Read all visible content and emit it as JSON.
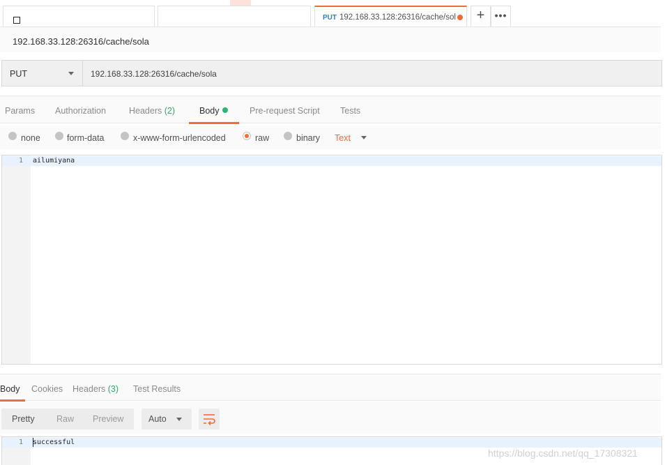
{
  "tabs": [
    {
      "title": ""
    },
    {
      "title": ""
    },
    {
      "method": "PUT",
      "title": "192.168.33.128:26316/cache/sol",
      "unsaved": true
    }
  ],
  "tab_actions": {
    "add_label": "+",
    "more_label": "•••"
  },
  "request": {
    "title": "192.168.33.128:26316/cache/sola",
    "method": "PUT",
    "url": "192.168.33.128:26316/cache/sola"
  },
  "request_tabs": [
    {
      "label": "Params"
    },
    {
      "label": "Authorization"
    },
    {
      "label": "Headers",
      "count": "(2)"
    },
    {
      "label": "Body",
      "active": true
    },
    {
      "label": "Pre-request Script"
    },
    {
      "label": "Tests"
    }
  ],
  "body_types": [
    {
      "label": "none"
    },
    {
      "label": "form-data"
    },
    {
      "label": "x-www-form-urlencoded"
    },
    {
      "label": "raw",
      "selected": true
    },
    {
      "label": "binary"
    }
  ],
  "body_format": "Text",
  "request_body": {
    "line_number": "1",
    "content": "ailumiyana"
  },
  "response_tabs": [
    {
      "label": "Body",
      "active": true
    },
    {
      "label": "Cookies"
    },
    {
      "label": "Headers",
      "count": "(3)"
    },
    {
      "label": "Test Results"
    }
  ],
  "response_views": {
    "pretty": "Pretty",
    "raw": "Raw",
    "preview": "Preview",
    "format": "Auto"
  },
  "response_body": {
    "line_number": "1",
    "content": "successful"
  },
  "watermark": "https://blog.csdn.net/qq_17308321",
  "colors": {
    "accent": "#f26b3a",
    "success": "#2fa868",
    "method_blue": "#2f7bd6"
  },
  "icons": {
    "wrap": "wrap-lines-icon",
    "add": "plus-icon",
    "more": "more-icon"
  }
}
